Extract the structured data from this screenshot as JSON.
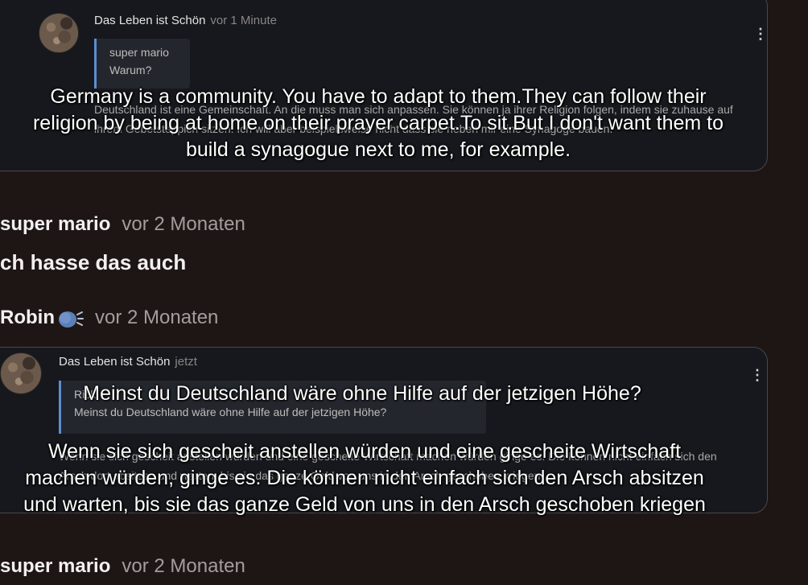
{
  "cards": [
    {
      "author": "Das Leben ist Schön",
      "time": "vor 1 Minute",
      "quote_author": "super mario",
      "quote_text": "Warum?",
      "body": "Deutschland ist eine Gemeinschaft. An die muss man sich anpassen. Sie können ja ihrer Religion folgen, indem sie zuhause auf ihrem Gebetsteppich sitzen. Ich will aber beispielsweise nicht dass sie neben mir eine Synagoge bauen.",
      "subtitle": "Germany is a community. You have to adapt to them.They can follow their religion by being at home on their prayer carpet.To sit.But I don't want them to build a synagogue next to me, for example."
    },
    {
      "author": "Das Leben ist Schön",
      "time": "jetzt",
      "quote_author": "Rick",
      "quote_text": "Meinst du Deutschland wäre ohne Hilfe auf der jetzigen Höhe?",
      "body": "Wenn sie sich gescheit anstellen würden und eine gescheite Wirtschaft machen würden ginge es. Die können nicht einfach sich den Arsch dort absitzen und warten, bis sie das ganze Geld von uns in den Arsch geschoben kriegen",
      "subtitle_top": "Meinst du Deutschland wäre ohne Hilfe auf der jetzigen Höhe?",
      "subtitle": "Wenn sie sich gescheit anstellen würden und eine gescheite Wirtschaft machen würden, ginge es. Die können nicht einfach sich den Arsch absitzen und warten, bis sie das ganze Geld von uns in den Arsch geschoben kriegen"
    }
  ],
  "comments": [
    {
      "author": "super mario",
      "time": "vor 2 Monaten",
      "text": "ch hasse das auch"
    },
    {
      "author": "Robin",
      "emoji": "speaking-head-icon",
      "time": "vor 2 Monaten"
    },
    {
      "author": "super mario",
      "time": "vor 2 Monaten"
    }
  ]
}
